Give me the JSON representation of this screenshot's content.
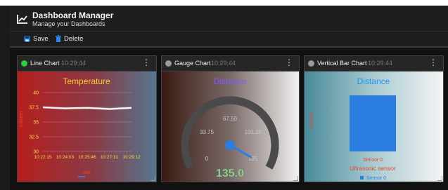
{
  "header": {
    "title": "Dashboard Manager",
    "subtitle": "Manage your Dashboards"
  },
  "toolbar": {
    "save_label": "Save",
    "delete_label": "Delete"
  },
  "panels": [
    {
      "title": "Line Chart",
      "time": "10:29:44",
      "status_color": "#2ecc40",
      "chart_title": "Temperature",
      "ylabel": "column",
      "xlabel": "row",
      "y_ticks": [
        "40",
        "37.5",
        "35",
        "32.5",
        "30"
      ],
      "x_ticks": [
        "10:22:15",
        "10:24:03",
        "10:25:46",
        "10:27:31",
        "10:29:12"
      ]
    },
    {
      "title": "Gauge Chart",
      "time": "10:29:44",
      "status_color": "#9a9a9a",
      "chart_title": "Distance",
      "gauge_ticks": [
        "0",
        "33.75",
        "67.50",
        "101.25",
        "135"
      ],
      "value": "135.0"
    },
    {
      "title": "Vertical Bar Chart",
      "time": "10:29:44",
      "status_color": "#9a9a9a",
      "chart_title": "Distance",
      "ylabel": "column",
      "category": "Sensor 0",
      "xlabel": "Ultrasonic sensor",
      "legend": "Sensor 0"
    }
  ],
  "colors": {
    "line_chart_title": "#ffcc33",
    "gauge_title": "#7b5cff",
    "bar_title": "#2196f3",
    "bar_fill": "#2b7de0",
    "axis_text_red": "#e8442a",
    "axis_tick_yellow": "#ffd84a"
  },
  "chart_data": [
    {
      "type": "line",
      "title": "Temperature",
      "x": [
        "10:22:15",
        "10:24:03",
        "10:25:46",
        "10:27:31",
        "10:29:12"
      ],
      "xlabel": "row",
      "ylabel": "column",
      "ylim": [
        30,
        40
      ],
      "series": [
        {
          "values": [
            37.5,
            37.3,
            37.4,
            37.2,
            37.4
          ]
        }
      ],
      "grid": true
    },
    {
      "type": "gauge",
      "title": "Distance",
      "min": 0,
      "max": 135,
      "ticks": [
        0,
        33.75,
        67.5,
        101.25,
        135
      ],
      "value": 135.0
    },
    {
      "type": "bar",
      "title": "Distance",
      "categories": [
        "Sensor 0"
      ],
      "values": [
        135
      ],
      "xlabel": "Ultrasonic sensor",
      "ylabel": "column",
      "legend": "Sensor 0"
    }
  ]
}
